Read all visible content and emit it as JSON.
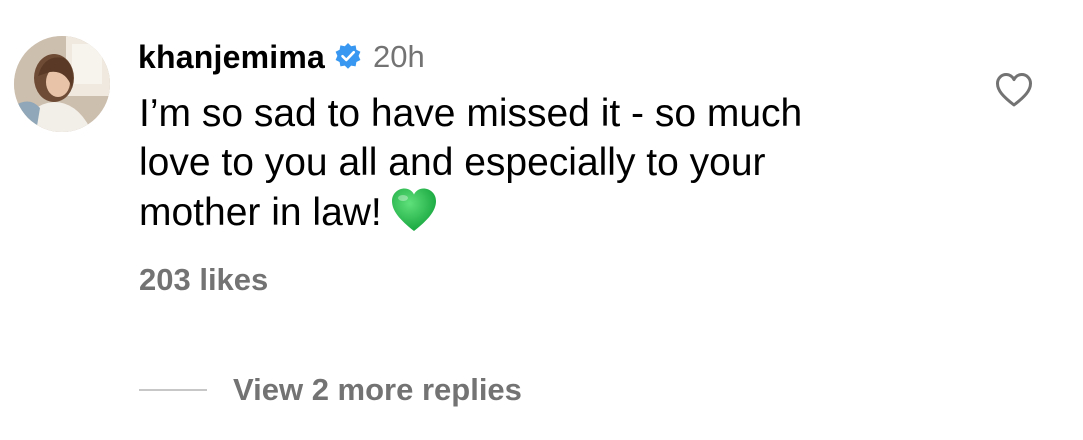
{
  "comment": {
    "username": "khanjemima",
    "verified": true,
    "verified_color": "#3897f0",
    "timestamp": "20h",
    "text_lines": [
      "I’m so sad to have missed it - so much",
      "love to you all and especially to your",
      "mother in law!"
    ],
    "emoji": "green-heart",
    "likes": "203 likes",
    "like_icon": "heart-outline-icon",
    "view_replies": "View 2 more replies"
  },
  "colors": {
    "text": "#000000",
    "secondary": "#737373",
    "divider": "#c7c7c7",
    "emoji_green": "#22b14c"
  }
}
